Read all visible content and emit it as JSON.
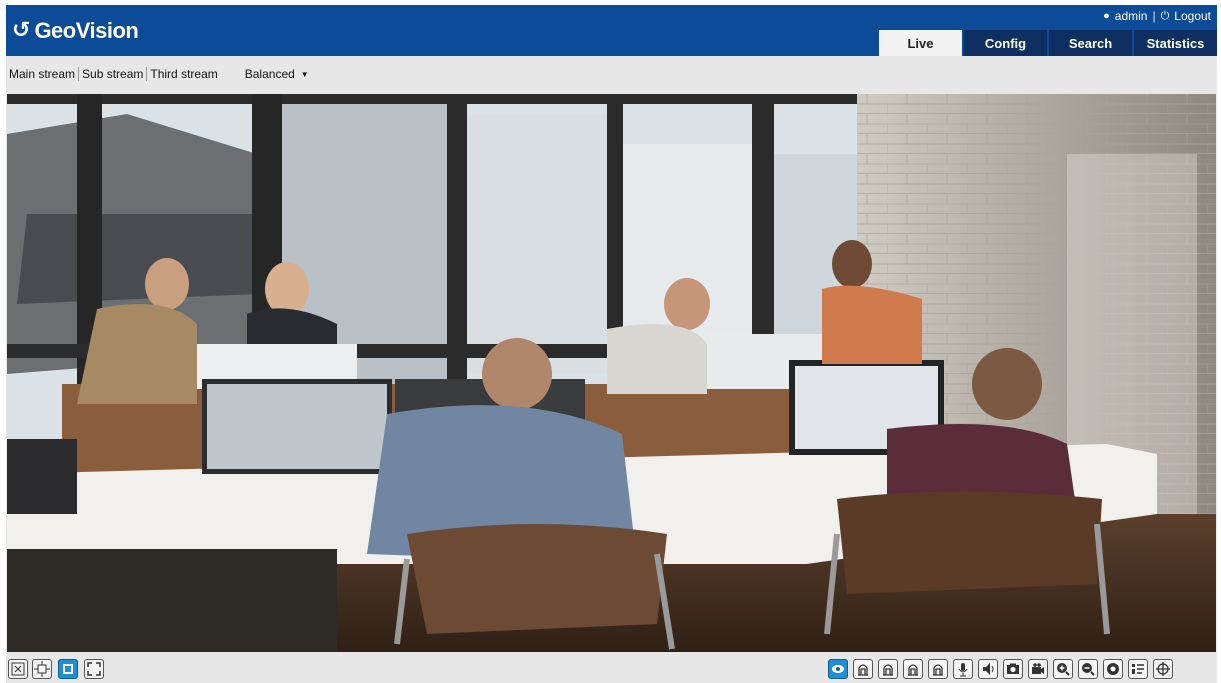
{
  "brand": {
    "name": "GeoVision"
  },
  "user": {
    "name": "admin",
    "logout_label": "Logout"
  },
  "tabs": [
    {
      "label": "Live",
      "active": true
    },
    {
      "label": "Config",
      "active": false
    },
    {
      "label": "Search",
      "active": false
    },
    {
      "label": "Statistics",
      "active": false
    }
  ],
  "streams": {
    "main": "Main stream",
    "sub": "Sub stream",
    "third": "Third stream"
  },
  "quality": {
    "selected": "Balanced"
  },
  "colors": {
    "header": "#0b4b98",
    "tab_inactive": "#0e2f5f",
    "tab_active": "#f2f2f2",
    "toolbar_accent": "#1d8fd6"
  },
  "video_toolbar_left": [
    {
      "icon": "original-size-icon"
    },
    {
      "icon": "fit-to-window-icon"
    },
    {
      "icon": "stretch-icon",
      "active": true
    },
    {
      "icon": "fullscreen-icon"
    }
  ],
  "video_toolbar_right": [
    {
      "icon": "eye-icon",
      "active": true
    },
    {
      "icon": "digital-output-1-icon"
    },
    {
      "icon": "digital-output-2-icon"
    },
    {
      "icon": "digital-output-3-icon"
    },
    {
      "icon": "digital-output-4-icon"
    },
    {
      "icon": "microphone-icon"
    },
    {
      "icon": "speaker-icon"
    },
    {
      "icon": "snapshot-icon"
    },
    {
      "icon": "record-icon"
    },
    {
      "icon": "zoom-in-icon"
    },
    {
      "icon": "zoom-out-icon"
    },
    {
      "icon": "ptz-icon"
    },
    {
      "icon": "stream-info-icon"
    },
    {
      "icon": "crosshair-icon"
    }
  ]
}
